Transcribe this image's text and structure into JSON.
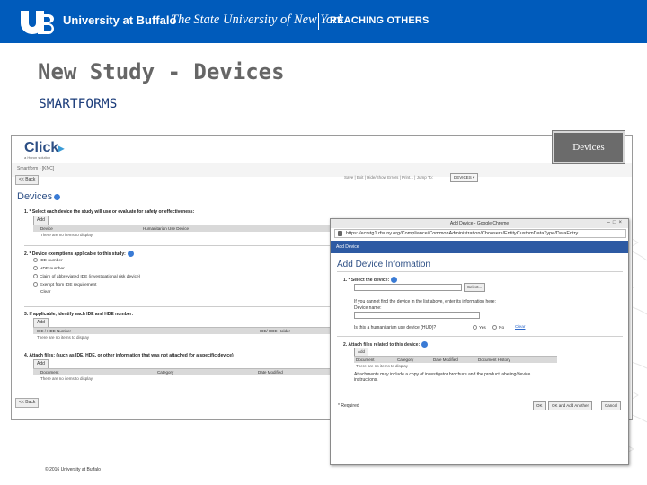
{
  "header": {
    "university_name": "University at Buffalo",
    "tagline": "The State University of New York",
    "motto": "REACHING OTHERS",
    "brand_color": "#005bbb"
  },
  "slide": {
    "title": "New Study - Devices",
    "subtitle": "SMARTFORMS",
    "badge": "Devices"
  },
  "app": {
    "logo": "Click",
    "logo_tagline": "a Huron solution",
    "breadcrumb": "Smartform - [KNC]",
    "back_top": "<< Back",
    "toolbar_text": "Save | Exit | Hide/Show Errors | Print... | Jump To:",
    "jump_select": "DEVICES",
    "section_title": "Devices",
    "q1": {
      "label": "1. * Select each device the study will use or evaluate for safety or effectiveness:",
      "add": "Add",
      "cols": [
        "Device",
        "Humanitarian Use Device"
      ],
      "empty": "There are no items to display"
    },
    "q2": {
      "label": "2. * Device exemptions applicable to this study:",
      "options": [
        "IDE number",
        "HDE number",
        "Claim of abbreviated IDE (investigational risk device)",
        "Exempt from IDE requirement"
      ],
      "clear": "Clear"
    },
    "q3": {
      "label": "3. If applicable, identify each IDE and HDE number:",
      "add": "Add",
      "cols": [
        "IDE / HDE Number",
        "IDE/ HDE Holder"
      ],
      "empty": "There are no items to display"
    },
    "q4": {
      "label": "4. Attach files: (such as IDE, HDE, or other information that was not attached for a specific device)",
      "add": "Add",
      "cols": [
        "Document",
        "Category",
        "Date Modified"
      ],
      "empty": "There are no items to display"
    },
    "back_bottom": "<< Back"
  },
  "popup": {
    "window_title": "Add Device - Google Chrome",
    "url": "https://ecrstg1.rfsuny.org/Compliance/CommonAdministration/Choosers/EntityCustomDataType/DataEntry",
    "bar_label": "Add Device",
    "heading": "Add Device Information",
    "q1_label": "1. * Select the device:",
    "select_btn": "Select...",
    "not_found_text": "If you cannot find the device in the list above, enter its information here:",
    "device_name_label": "Device name:",
    "hud_label": "Is this a humanitarian use device (HUD)?",
    "yes": "Yes",
    "no": "No",
    "clear": "Clear",
    "q2_label": "2. Attach files related to this device:",
    "add": "Add",
    "cols": [
      "Document",
      "Category",
      "Date Modified",
      "Document History"
    ],
    "empty": "There are no items to display",
    "note": "Attachments may include a copy of investigator brochure and the product labeling/device instructions.",
    "required": "* Required",
    "ok": "OK",
    "ok_add": "OK and Add Another",
    "cancel": "Cancel"
  },
  "footer": {
    "copyright": "© 2016 University at Buffalo"
  }
}
